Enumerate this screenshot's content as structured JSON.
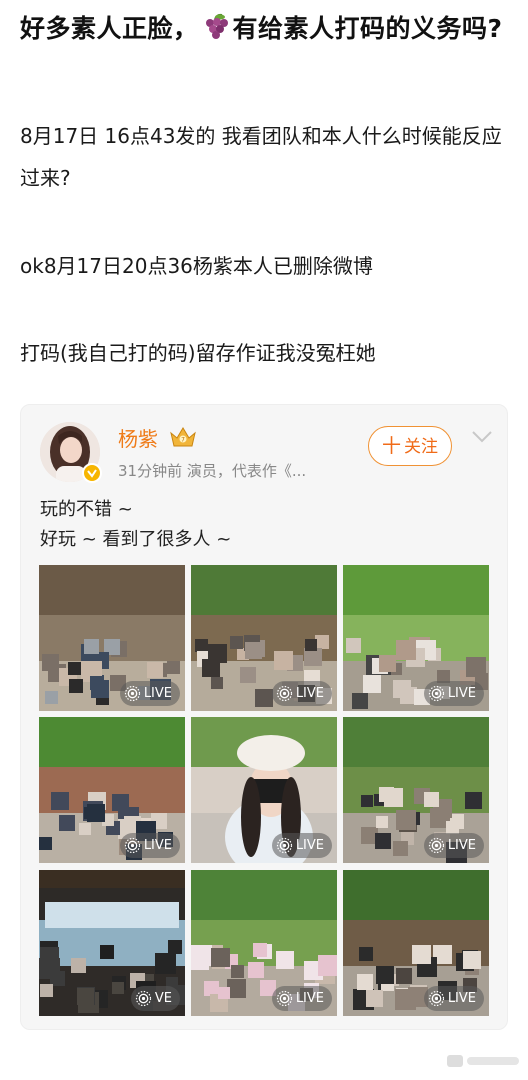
{
  "post": {
    "title_part1": "好多素人正脸，",
    "title_part2": "有给素人打码的义务吗?",
    "para1": "8月17日 16点43发的 我看团队和本人什么时候能反应过来?",
    "para2": "ok8月17日20点36杨紫本人已删除微博",
    "para3": "打码(我自己打的码)留存作证我没冤枉她",
    "title_emoji": "grapes-emoji"
  },
  "card": {
    "username": "杨紫",
    "meta": "31分钟前  演员，代表作《...",
    "follow_label": "关注",
    "follow_plus": "十",
    "line1": "玩的不错 ~",
    "line2": "好玩 ~ 看到了很多人 ~",
    "accent": "#ef7b18",
    "photos": [
      {
        "badge": "LIVE",
        "scene": "street"
      },
      {
        "badge": "LIVE",
        "scene": "pavilion"
      },
      {
        "badge": "LIVE",
        "scene": "trees"
      },
      {
        "badge": "LIVE",
        "scene": "garden"
      },
      {
        "badge": "LIVE",
        "scene": "selfie"
      },
      {
        "badge": "LIVE",
        "scene": "forest"
      },
      {
        "badge": "VE",
        "scene": "lake-view"
      },
      {
        "badge": "LIVE",
        "scene": "park"
      },
      {
        "badge": "LIVE",
        "scene": "old-tree"
      }
    ]
  }
}
